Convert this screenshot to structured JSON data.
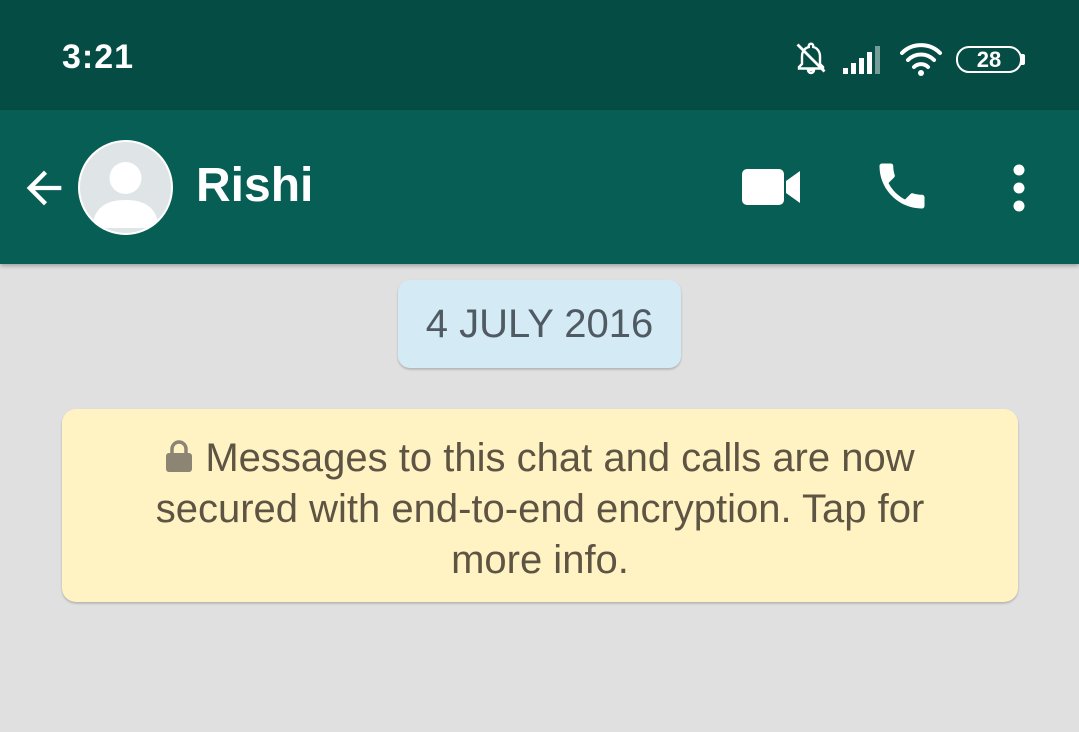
{
  "status_bar": {
    "time": "3:21",
    "battery_level": "28",
    "icons": [
      "notifications-muted-icon",
      "signal-icon",
      "wifi-icon",
      "battery-icon"
    ]
  },
  "header": {
    "contact_name": "Rishi",
    "icons": [
      "back-arrow-icon",
      "avatar-placeholder-icon",
      "video-call-icon",
      "phone-icon",
      "more-vert-icon"
    ]
  },
  "chat": {
    "date_label": "4 JULY 2016",
    "encryption_notice": "Messages to this chat and calls are now secured with end-to-end encryption. Tap for more info."
  },
  "colors": {
    "status_bar": "#054d44",
    "app_bar": "#075e54",
    "chat_background": "#e0e0e0",
    "date_chip": "#d4eaf4",
    "notice_background": "#fff3c4",
    "notice_text": "#5e5443"
  }
}
